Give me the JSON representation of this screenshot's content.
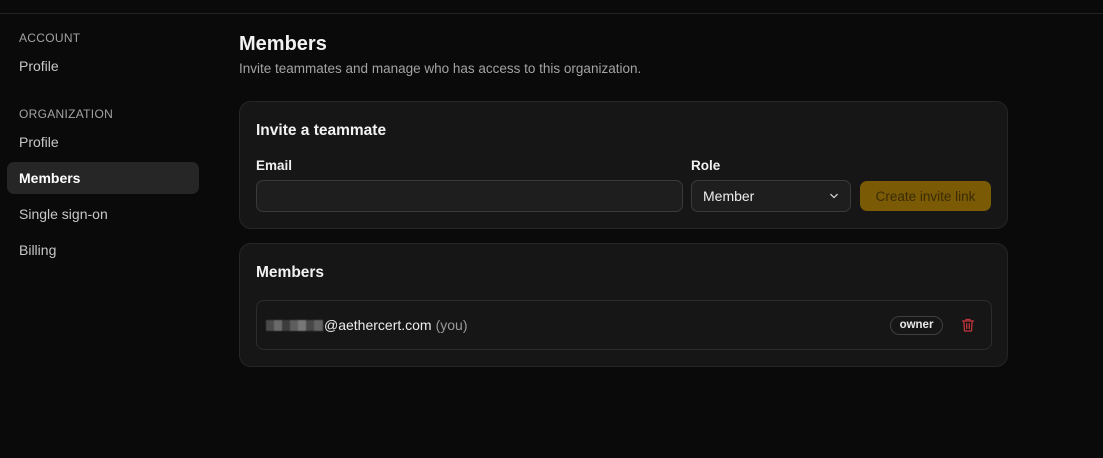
{
  "sidebar": {
    "account_label": "ACCOUNT",
    "account_items": [
      {
        "label": "Profile"
      }
    ],
    "org_label": "ORGANIZATION",
    "org_items": [
      {
        "label": "Profile"
      },
      {
        "label": "Members"
      },
      {
        "label": "Single sign-on"
      },
      {
        "label": "Billing"
      }
    ],
    "active": "Members"
  },
  "page": {
    "title": "Members",
    "subtitle": "Invite teammates and manage who has access to this organization."
  },
  "invite": {
    "title": "Invite a teammate",
    "email_label": "Email",
    "email_value": "",
    "role_label": "Role",
    "role_value": "Member",
    "button_label": "Create invite link"
  },
  "members": {
    "title": "Members",
    "rows": [
      {
        "email_suffix": "@aethercert.com",
        "you_tag": "(you)",
        "role_badge": "owner"
      }
    ]
  },
  "colors": {
    "background": "#0a0a0a",
    "card": "#161616",
    "accent": "#7a5a05",
    "danger": "#c0353a"
  },
  "icons": {
    "role_select": "chevron-down-icon",
    "member_delete": "trash-icon"
  }
}
